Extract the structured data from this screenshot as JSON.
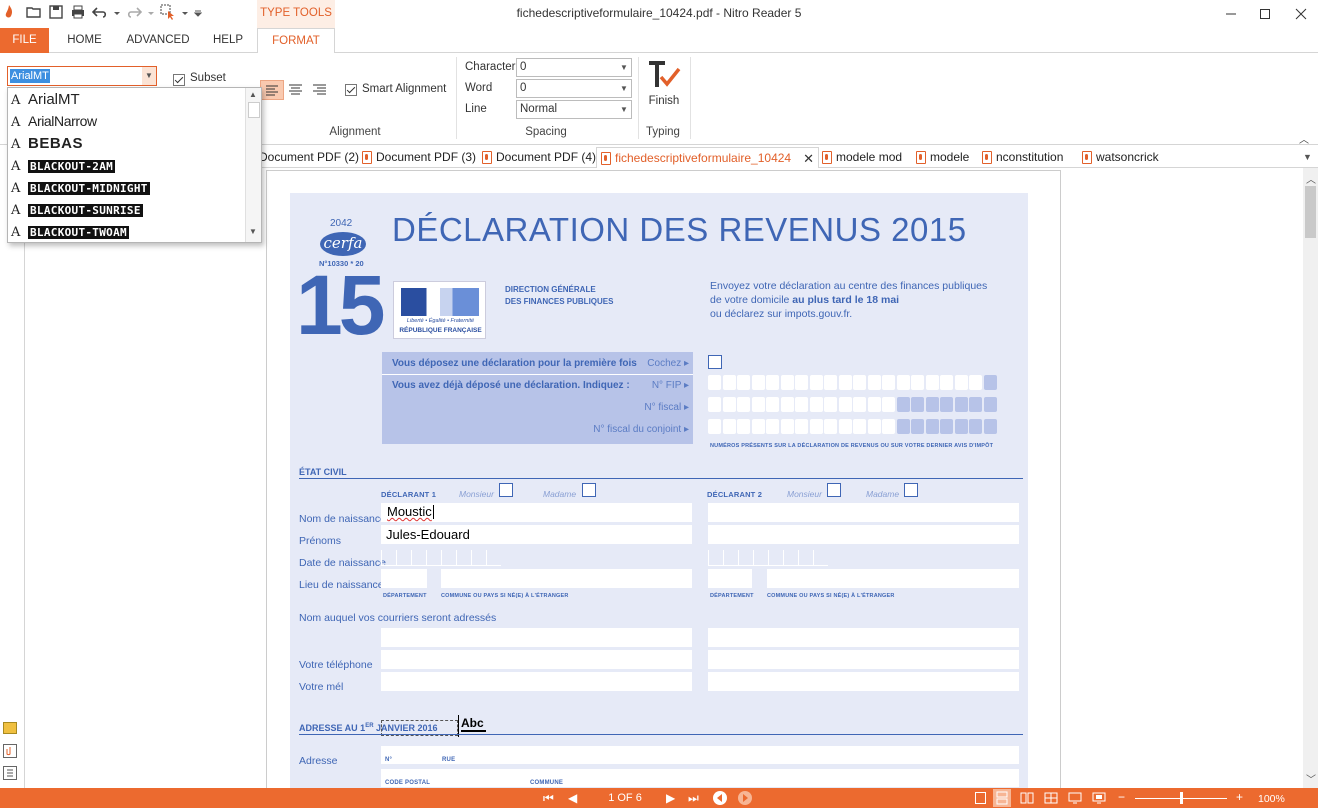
{
  "app": {
    "window_title": "fichedescriptiveformulaire_10424.pdf - Nitro Reader 5",
    "context_tab": "TYPE TOOLS"
  },
  "ribbon_tabs": [
    "FILE",
    "HOME",
    "ADVANCED",
    "HELP",
    "FORMAT"
  ],
  "font": {
    "selected": "ArialMT",
    "subset_label": "Subset",
    "subset_checked": true,
    "dropdown_items": [
      "ArialMT",
      "ArialNarrow",
      "BEBAS",
      "BLACKOUT-2AM",
      "BLACKOUT-MIDNIGHT",
      "BLACKOUT-SUNRISE",
      "BLACKOUT-TWOAM"
    ]
  },
  "alignment": {
    "smart_label": "Smart Alignment",
    "smart_checked": true,
    "group_label": "Alignment"
  },
  "spacing": {
    "character_label": "Character",
    "character_value": "0",
    "word_label": "Word",
    "word_value": "0",
    "line_label": "Line",
    "line_value": "Normal",
    "group_label": "Spacing"
  },
  "typing": {
    "finish_label": "Finish",
    "group_label": "Typing"
  },
  "doc_tabs": [
    "Document PDF (2)",
    "Document PDF (3)",
    "Document PDF (4)",
    "fichedescriptiveformulaire_10424",
    "modele mod",
    "modele",
    "nconstitution",
    "watsoncrick"
  ],
  "form": {
    "cerfa_number": "2042",
    "cerfa_word": "cerfa",
    "cerfa_ref": "N°10330 * 20",
    "title": "DÉCLARATION DES REVENUS 2015",
    "big_number": "15",
    "logo_line1": "Liberté • Égalité • Fraternité",
    "logo_line2": "RÉPUBLIQUE FRANÇAISE",
    "dgfip_line1": "DIRECTION GÉNÉRALE",
    "dgfip_line2": "DES FINANCES PUBLIQUES",
    "send_line1": "Envoyez votre déclaration au centre des finances publiques",
    "send_line2a": "de votre domicile ",
    "send_line2b": "au plus tard le 18 mai",
    "send_line3": "ou déclarez sur impots.gouv.fr.",
    "first_time": "Vous déposez une déclaration pour la première fois",
    "cochez": "Cochez ▸",
    "already": "Vous avez déjà déposé une déclaration. Indiquez :",
    "nfip": "N° FIP ▸",
    "nfiscal": "N° fiscal ▸",
    "nfiscal_conj": "N° fiscal du conjoint ▸",
    "numeros_note": "NUMÉROS PRÉSENTS SUR LA DÉCLARATION DE REVENUS OU SUR VOTRE DERNIER AVIS D'IMPÔT",
    "etat_civil": "ÉTAT CIVIL",
    "declarant1": "DÉCLARANT 1",
    "declarant2": "DÉCLARANT 2",
    "monsieur": "Monsieur",
    "madame": "Madame",
    "nom_naissance": "Nom de naissance",
    "prenoms": "Prénoms",
    "date_naissance": "Date de naissance",
    "lieu_naissance": "Lieu de naissance",
    "departement": "DÉPARTEMENT",
    "commune_pays": "COMMUNE OU PAYS SI NÉ(E) À L'ÉTRANGER",
    "nom_courriers": "Nom auquel vos courriers seront adressés",
    "telephone": "Votre téléphone",
    "mel": "Votre mél",
    "nom_value": "Moustic",
    "prenom_value": "Jules-Edouard",
    "adresse_title_a": "ADRESSE AU 1",
    "adresse_title_sup": "ER",
    "adresse_title_b": " JANVIER 2016",
    "abc": "Abc",
    "adresse": "Adresse",
    "n_label": "N°",
    "rue_label": "RUE",
    "code_postal": "CODE POSTAL",
    "commune": "COMMUNE"
  },
  "status": {
    "page": "1 OF 6",
    "zoom": "100%",
    "zoom_level": 0.5
  },
  "colors": {
    "accent": "#ec6a2f",
    "form_blue": "#3f66b5",
    "form_bg": "#e6eaf7"
  }
}
